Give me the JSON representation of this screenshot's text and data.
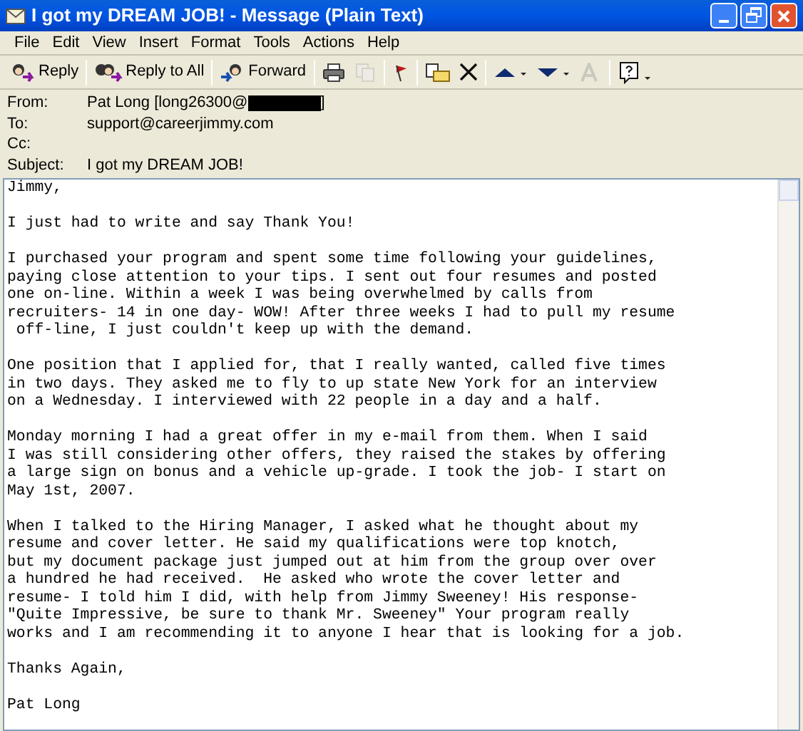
{
  "window": {
    "title": "I got my DREAM JOB! - Message (Plain Text)"
  },
  "menu": [
    "File",
    "Edit",
    "View",
    "Insert",
    "Format",
    "Tools",
    "Actions",
    "Help"
  ],
  "toolbar": [
    {
      "kind": "reply",
      "label": "Reply"
    },
    {
      "kind": "reply_all",
      "label": "Reply to All"
    },
    {
      "kind": "forward",
      "label": "Forward"
    },
    {
      "kind": "print"
    },
    {
      "kind": "copy",
      "disabled": true
    },
    {
      "kind": "flag"
    },
    {
      "kind": "move"
    },
    {
      "kind": "delete"
    },
    {
      "kind": "previous"
    },
    {
      "kind": "next"
    },
    {
      "kind": "font",
      "disabled": true
    },
    {
      "kind": "help"
    }
  ],
  "headers": [
    {
      "label": "From:",
      "value": "Pat Long [long26300@",
      "redacted": true,
      "value_end": "]"
    },
    {
      "label": "To:",
      "value": "support@careerjimmy.com"
    },
    {
      "label": "Cc:"
    },
    {
      "label": "Subject:",
      "value": "I got my DREAM JOB!"
    }
  ],
  "body": [
    [
      "Jimmy,"
    ],
    [
      "I just had to write and say Thank You!"
    ],
    [
      "I purchased your program and spent some time following your guidelines,",
      "paying close attention to your tips. I sent out four resumes and posted",
      "one on-line. Within a week I was being overwhelmed by calls from",
      "recruiters- 14 in one day- WOW! After three weeks I had to pull my resume",
      " off-line, I just couldn't keep up with the demand."
    ],
    [
      "One position that I applied for, that I really wanted, called five times",
      "in two days. They asked me to fly to up state New York for an interview",
      "on a Wednesday. I interviewed with 22 people in a day and a half."
    ],
    [
      "Monday morning I had a great offer in my e-mail from them. When I said",
      "I was still considering other offers, they raised the stakes by offering",
      "a large sign on bonus and a vehicle up-grade. I took the job- I start on",
      "May 1st, 2007."
    ],
    [
      "When I talked to the Hiring Manager, I asked what he thought about my",
      "resume and cover letter. He said my qualifications were top knotch,",
      "but my document package just jumped out at him from the group over over",
      "a hundred he had received.  He asked who wrote the cover letter and",
      "resume- I told him I did, with help from Jimmy Sweeney! His response-",
      "\"Quite Impressive, be sure to thank Mr. Sweeney\" Your program really",
      "works and I am recommending it to anyone I hear that is looking for a job."
    ],
    [
      "Thanks Again,"
    ],
    [
      "Pat Long"
    ]
  ]
}
